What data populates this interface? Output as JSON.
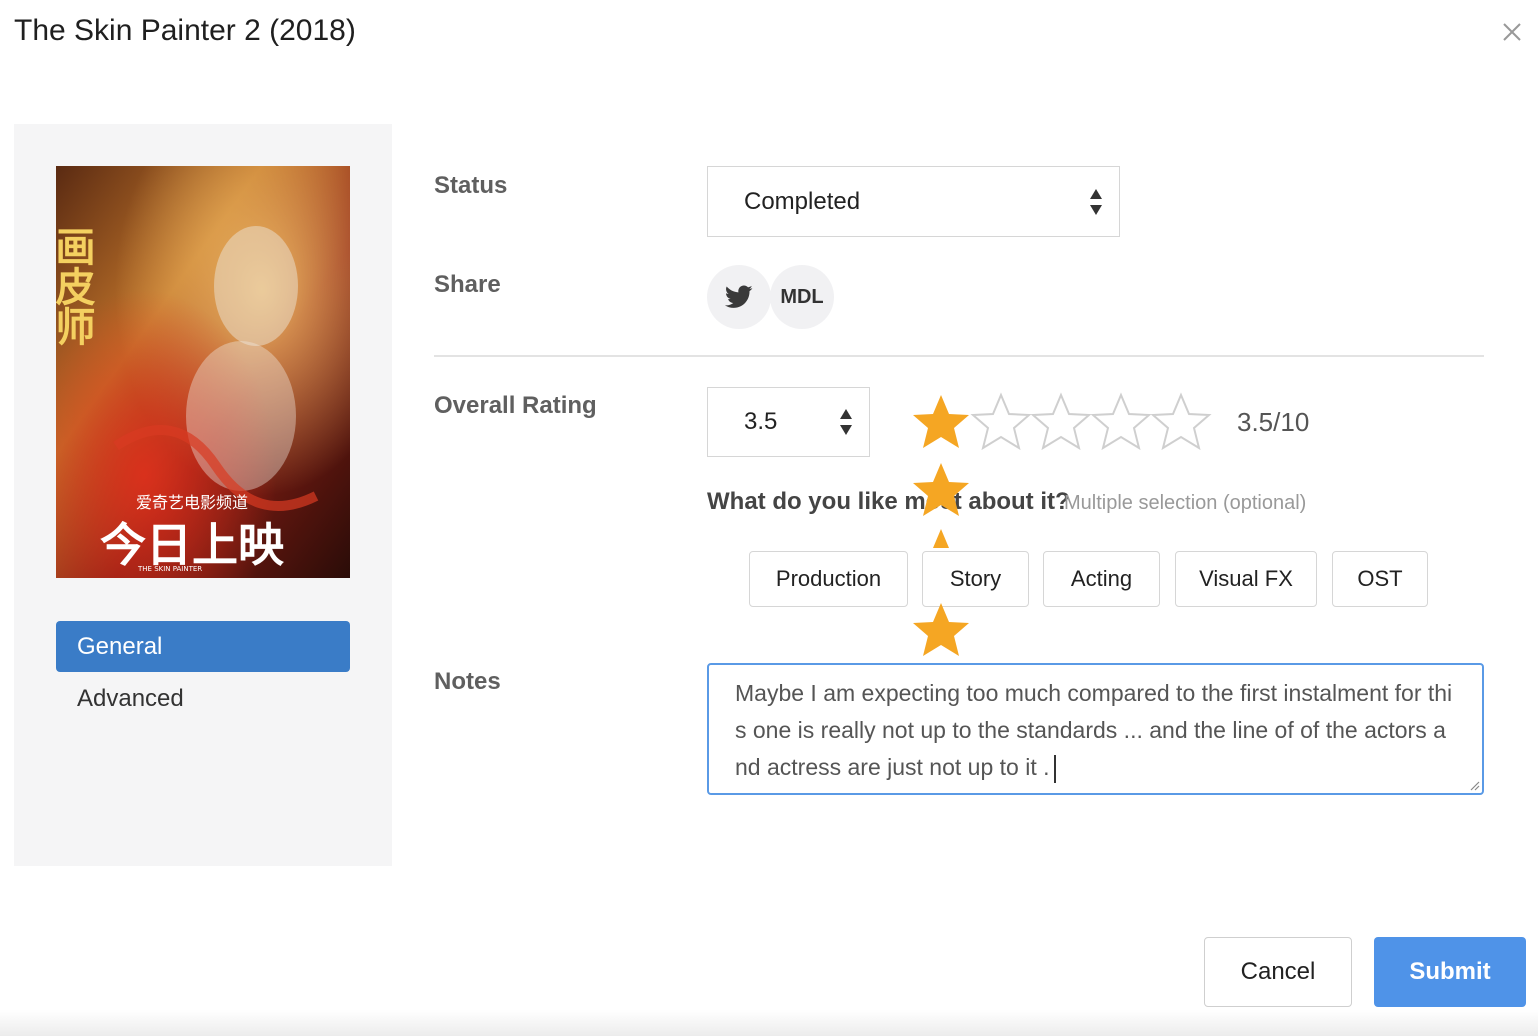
{
  "modal": {
    "title": "The Skin Painter 2 (2018)"
  },
  "sidebar": {
    "poster": {
      "title_chars": "画皮师",
      "channel": "爱奇艺电影频道",
      "tagline": "今日上映",
      "watermark": "THE SKIN PAINTER"
    },
    "items": [
      {
        "label": "General",
        "active": true
      },
      {
        "label": "Advanced",
        "active": false
      }
    ]
  },
  "form": {
    "status": {
      "label": "Status",
      "value": "Completed"
    },
    "share": {
      "label": "Share",
      "mdl_label": "MDL"
    },
    "rating": {
      "label": "Overall Rating",
      "value": "3.5",
      "display": "3.5/10",
      "max_stars": 5,
      "filled_stars": 1
    },
    "question": {
      "text": "What do you like most about it?",
      "hint": "Multiple selection (optional)"
    },
    "tags": [
      "Production",
      "Story",
      "Acting",
      "Visual FX",
      "OST"
    ],
    "notes": {
      "label": "Notes",
      "value": "Maybe I am expecting too much compared to the first instalment  for this one is really not up to the standards  ... and the line of of the actors and actress are just not up to it  ."
    }
  },
  "footer": {
    "cancel_label": "Cancel",
    "submit_label": "Submit"
  },
  "colors": {
    "accent": "#3a7cc7",
    "submit": "#4f93e8",
    "star": "#f5a623",
    "focus_border": "#5a9ae6"
  }
}
